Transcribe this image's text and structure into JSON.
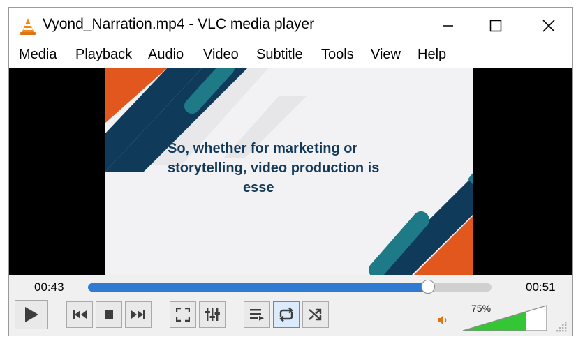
{
  "window": {
    "title": "Vyond_Narration.mp4 - VLC media player",
    "minimize_glyph": "—",
    "maximize_glyph": "☐",
    "close_glyph": "✕"
  },
  "menu": [
    "Media",
    "Playback",
    "Audio",
    "Video",
    "Subtitle",
    "Tools",
    "View",
    "Help"
  ],
  "video": {
    "caption_lines": [
      "So, whether for marketing or",
      "storytelling, video production is",
      "esse"
    ],
    "colors": {
      "navy": "#0f3a5a",
      "teal": "#1e7a86",
      "orange": "#e2571e",
      "background": "#f2f2f4"
    }
  },
  "seek": {
    "elapsed": "00:43",
    "total": "00:51",
    "progress": 0.843
  },
  "controls": {
    "buttons": [
      "play-icon",
      "previous-icon",
      "stop-icon",
      "next-icon",
      "fullscreen-icon",
      "extended-settings-icon",
      "playlist-icon",
      "loop-icon",
      "shuffle-icon"
    ],
    "loop_active": true
  },
  "volume": {
    "level_label": "75%",
    "level": 0.75,
    "accent": "#35c635"
  }
}
